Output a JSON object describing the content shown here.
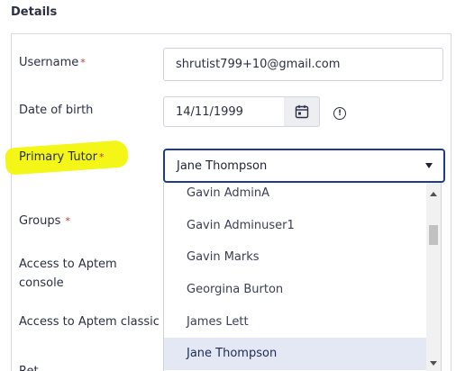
{
  "section": {
    "title": "Details"
  },
  "fields": {
    "username": {
      "label": "Username",
      "value": "shrutist799+10@gmail.com"
    },
    "dob": {
      "label": "Date of birth",
      "value": "14/11/1999"
    },
    "primary_tutor": {
      "label": "Primary Tutor",
      "value": "Jane Thompson"
    },
    "groups": {
      "label": "Groups"
    },
    "console": {
      "label": "Access to Aptem console"
    },
    "classic": {
      "label": "Access to Aptem classic"
    },
    "partial": {
      "label": "Ret"
    }
  },
  "required_marker": "*",
  "info_glyph": "!",
  "dropdown": {
    "options": [
      "Gavin AdminA",
      "Gavin Adminuser1",
      "Gavin Marks",
      "Georgina Burton",
      "James Lett",
      "Jane Thompson"
    ],
    "selected": "Jane Thompson"
  },
  "colors": {
    "focus_border": "#1f3c88",
    "highlight": "#f2f50a",
    "selected_option_bg": "#e4e7f4",
    "required": "#c0392b"
  }
}
